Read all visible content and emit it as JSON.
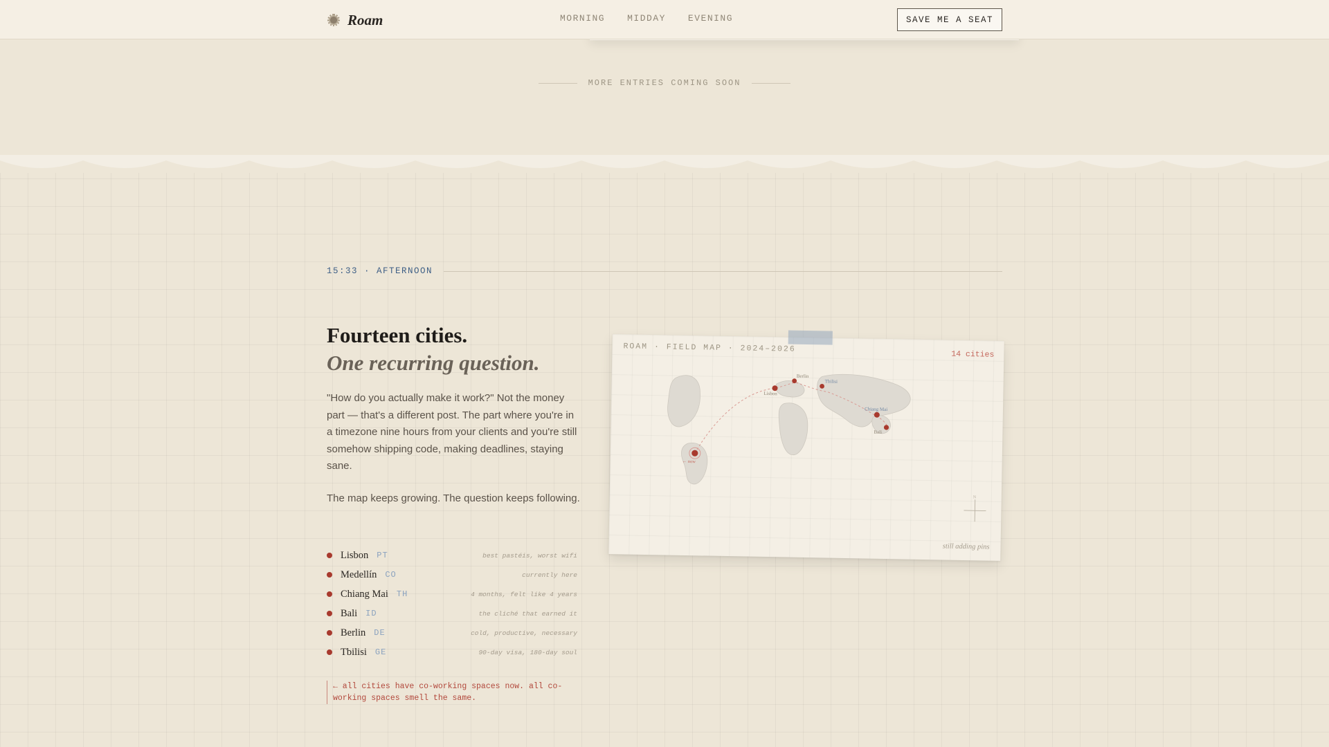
{
  "header": {
    "brand": "Roam",
    "nav": [
      "MORNING",
      "MIDDAY",
      "EVENING"
    ],
    "cta": "SAVE ME A SEAT"
  },
  "top_band": {
    "coming_soon": "MORE ENTRIES COMING SOON"
  },
  "entry": {
    "timestamp": "15:33 · AFTERNOON",
    "title": "Fourteen cities.",
    "subtitle": "One recurring question.",
    "paragraph1": "\"How do you actually make it work?\" Not the money part — that's a different post. The part where you're in a timezone nine hours from your clients and you're still somehow shipping code, making deadlines, staying sane.",
    "paragraph2": "The map keeps growing. The question keeps following.",
    "cities": [
      {
        "name": "Lisbon",
        "code": "PT",
        "note": "best pastéis, worst wifi"
      },
      {
        "name": "Medellín",
        "code": "CO",
        "note": "currently here"
      },
      {
        "name": "Chiang Mai",
        "code": "TH",
        "note": "4 months, felt like 4 years"
      },
      {
        "name": "Bali",
        "code": "ID",
        "note": "the cliché that earned it"
      },
      {
        "name": "Berlin",
        "code": "DE",
        "note": "cold, productive, necessary"
      },
      {
        "name": "Tbilisi",
        "code": "GE",
        "note": "90-day visa, 180-day soul"
      }
    ],
    "aside": "← all cities have co-working spaces now. all co-working spaces smell the same."
  },
  "map": {
    "label": "ROAM · FIELD MAP · 2024–2026",
    "count": "14 cities",
    "pins": [
      {
        "name": "Lisbon"
      },
      {
        "name": "Berlin"
      },
      {
        "name": "Tbilisi"
      },
      {
        "name": "Chiang Mai"
      },
      {
        "name": "Bali"
      },
      {
        "name": "← now"
      }
    ],
    "compass_letter": "N",
    "footer": "still adding pins",
    "colors": {
      "pin": "#a83a2e",
      "route": "#d99a93",
      "land": "#dcd8d0"
    }
  }
}
